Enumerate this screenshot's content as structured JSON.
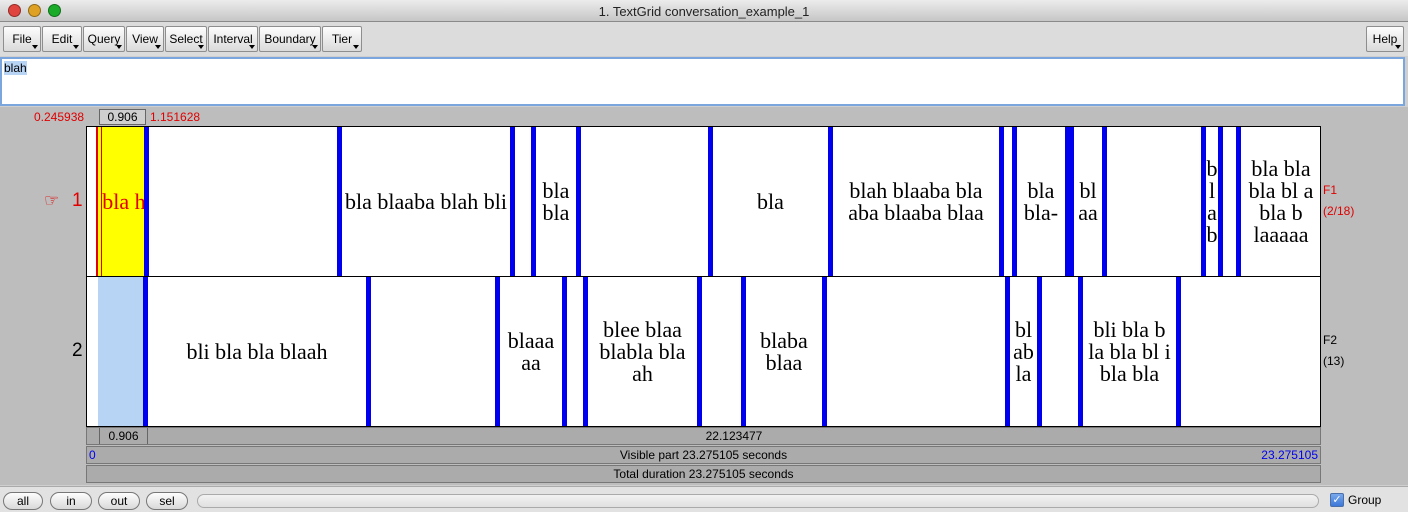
{
  "window": {
    "title": "1. TextGrid conversation_example_1",
    "traffic_lights": {
      "close": "#e0443e",
      "minimize": "#dea123",
      "zoom": "#1aab29"
    }
  },
  "menubar": {
    "items": [
      "File",
      "Edit",
      "Query",
      "View",
      "Select",
      "Interval",
      "Boundary",
      "Tier"
    ],
    "help": "Help"
  },
  "text_box": {
    "value": "blah"
  },
  "selection": {
    "start": "0.245938",
    "duration": "0.906",
    "end": "1.151628"
  },
  "tiers": [
    {
      "number": "1",
      "pointer_icon": "pointing-hand-icon",
      "name": "F1",
      "count": "(2/18)",
      "selected_label": "bla h",
      "labels": [
        "bla blaaba blah bli",
        "bla bla",
        "bla",
        "blah blaaba bla aba blaaba blaa",
        "bla bla-",
        "bl aa",
        "b l a b",
        "bla bla bla bl a bla b laaaaa"
      ]
    },
    {
      "number": "2",
      "name": "F2",
      "count": "(13)",
      "labels": [
        "bli bla bla blaah",
        "blaaa aa",
        "blee blaa blabla bla ah",
        "blaba blaa",
        "bl ab la",
        "bli bla b la bla bl i bla bla"
      ]
    }
  ],
  "durations": {
    "left": "0.906",
    "right": "22.123477"
  },
  "visible": {
    "start": "0",
    "label": "Visible part 23.275105 seconds",
    "end": "23.275105"
  },
  "total": {
    "label": "Total duration 23.275105 seconds"
  },
  "zoom_buttons": [
    "all",
    "in",
    "out",
    "sel"
  ],
  "group": {
    "label": "Group",
    "checked": true
  },
  "colors": {
    "boundary": "#0000ee",
    "selection_fill": "#ffff00",
    "cursor": "#e00000",
    "tier2_selection": "#b8d4f5"
  }
}
